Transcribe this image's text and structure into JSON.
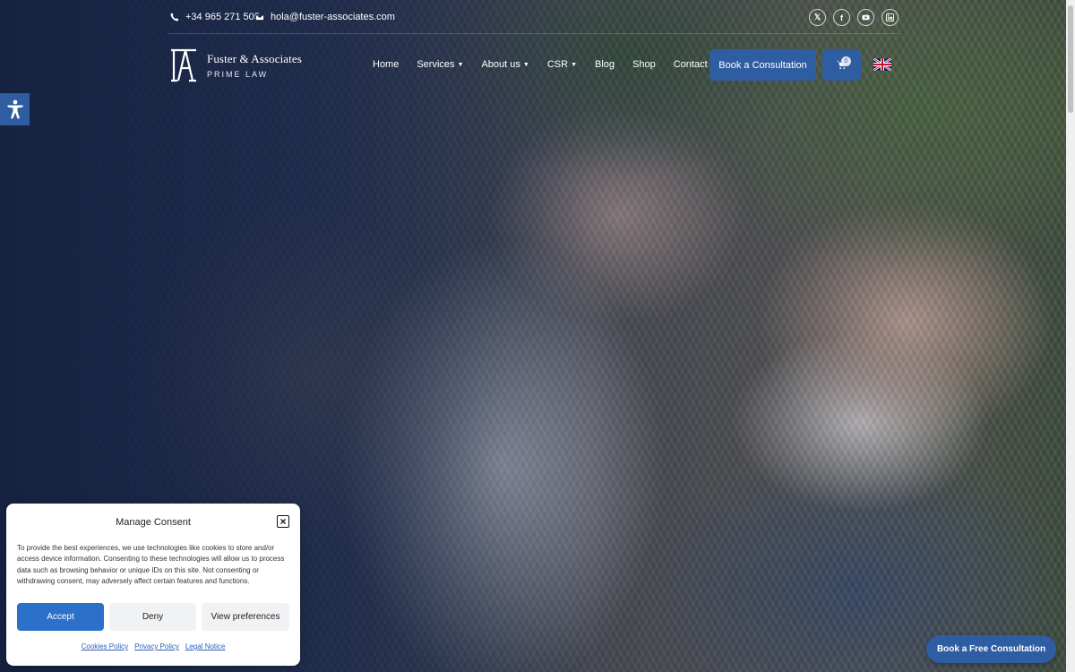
{
  "topbar": {
    "phone": "+34 965 271 505",
    "email": "hola@fuster-associates.com",
    "social_icons": [
      "x-icon",
      "facebook-icon",
      "youtube-icon",
      "linkedin-icon"
    ]
  },
  "brand": {
    "name": "Fuster & Associates",
    "tagline": "PRIME LAW"
  },
  "nav": {
    "items": [
      {
        "label": "Home",
        "dropdown": false
      },
      {
        "label": "Services",
        "dropdown": true
      },
      {
        "label": "About us",
        "dropdown": true
      },
      {
        "label": "CSR",
        "dropdown": true
      },
      {
        "label": "Blog",
        "dropdown": false
      },
      {
        "label": "Shop",
        "dropdown": false
      },
      {
        "label": "Contact us",
        "dropdown": false
      }
    ],
    "cta_label": "Book a Consultation",
    "cart_count": "0",
    "language_icon": "uk-flag-icon"
  },
  "consent": {
    "title": "Manage Consent",
    "body": "To provide the best experiences, we use technologies like cookies to store and/or access device information. Consenting to these technologies will allow us to process data such as browsing behavior or unique IDs on this site. Not consenting or withdrawing consent, may adversely affect certain features and functions.",
    "accept_label": "Accept",
    "deny_label": "Deny",
    "preferences_label": "View preferences",
    "links": [
      "Cookies Policy",
      "Privacy Policy",
      "Legal Notice"
    ]
  },
  "floating_cta": {
    "label": "Book a Free Consultation"
  },
  "colors": {
    "primary": "#2f5da1",
    "accept": "#2b71c9",
    "overlay": "#142140"
  }
}
